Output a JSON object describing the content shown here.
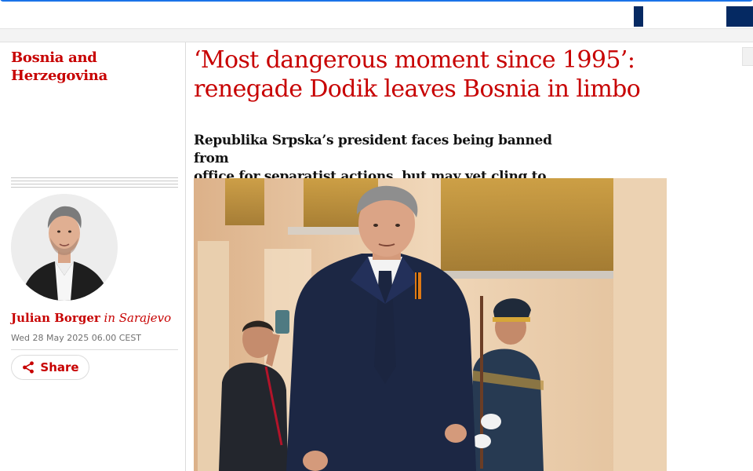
{
  "section": {
    "label_line1": "Bosnia and",
    "label_line2": "Herzegovina"
  },
  "article": {
    "headline_line1": "‘Most dangerous moment since 1995’:",
    "headline_line2": "renegade Dodik leaves Bosnia in limbo",
    "standfirst_line1": "Republika Srpska’s president faces being banned from",
    "standfirst_line2": "office for separatist actions, but may yet cling to power"
  },
  "byline": {
    "author": "Julian Borger",
    "location": " in Sarajevo"
  },
  "dateline": "Wed 28 May 2025 06.00 CEST",
  "share": {
    "label": "Share",
    "icon": "share-icon"
  },
  "colors": {
    "accent": "#c70000",
    "brand_navy": "#052962",
    "text": "#121212",
    "meta": "#707070"
  }
}
